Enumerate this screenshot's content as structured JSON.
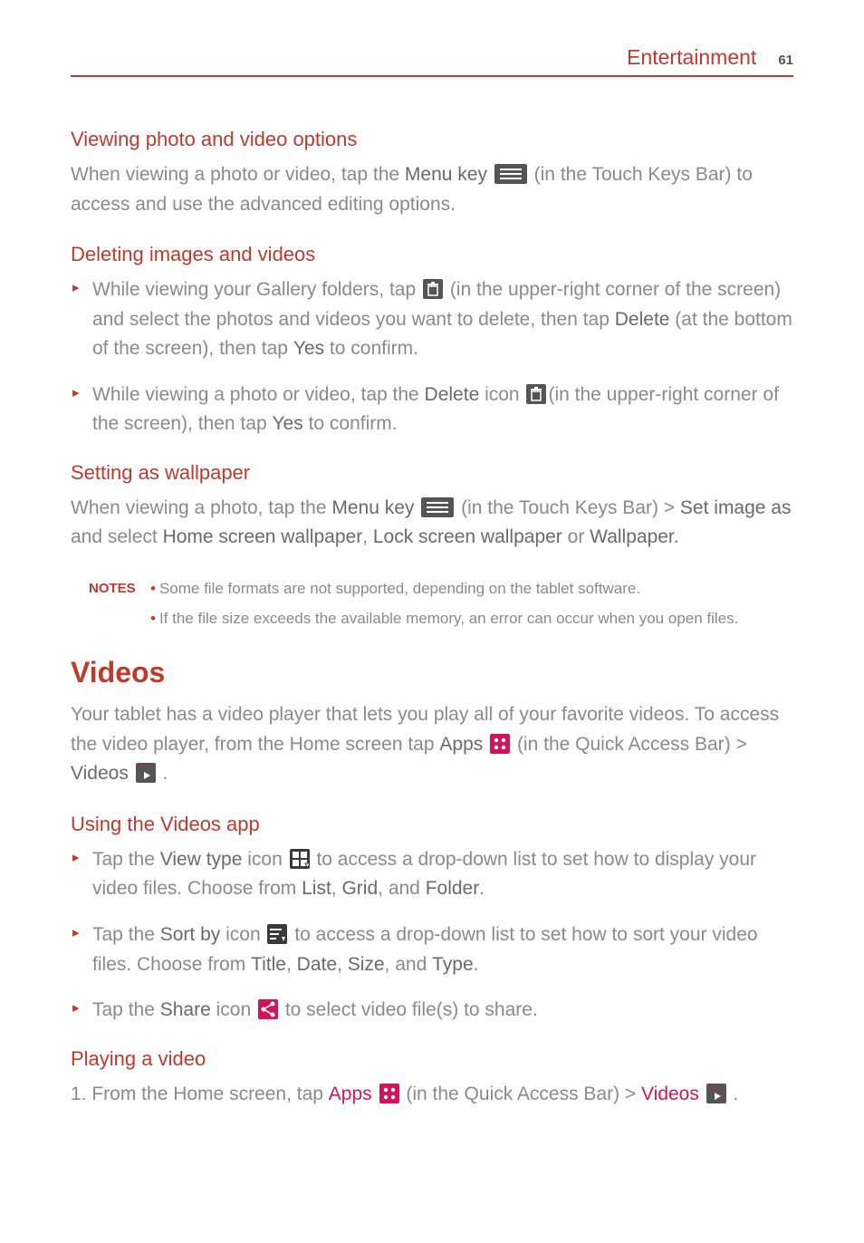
{
  "header": {
    "title": "Entertainment",
    "page": "61"
  },
  "s1": {
    "heading": "Viewing photo and video options",
    "p_a": "When viewing a photo or video, tap the ",
    "p_b": "Menu key",
    "p_c": " (in the Touch Keys Bar) to access and use the advanced editing options."
  },
  "s2": {
    "heading": "Deleting images and videos",
    "b1_a": "While viewing your Gallery folders, tap ",
    "b1_b": " (in the upper-right corner of the screen) and select the photos and videos you want to delete, then tap ",
    "b1_c": "Delete",
    "b1_d": " (at the bottom of the screen), then tap ",
    "b1_e": "Yes",
    "b1_f": " to confirm.",
    "b2_a": "While viewing a photo or video, tap the ",
    "b2_b": "Delete",
    "b2_c": " icon ",
    "b2_d": "(in the upper-right corner of the screen), then tap ",
    "b2_e": "Yes",
    "b2_f": " to confirm."
  },
  "s3": {
    "heading": "Setting as wallpaper",
    "p_a": "When viewing a photo, tap the ",
    "p_b": "Menu key",
    "p_c": " (in the Touch Keys Bar) > ",
    "p_d": "Set image as",
    "p_e": " and select ",
    "p_f": "Home screen wallpaper",
    "p_g": ", ",
    "p_h": "Lock screen wallpaper",
    "p_i": " or ",
    "p_j": "Wallpaper."
  },
  "notes": {
    "label": "NOTES",
    "n1": "Some file formats are not supported, depending on the tablet software.",
    "n2": "If the file size exceeds the available memory, an error can occur when you open files."
  },
  "s4": {
    "heading": "Videos",
    "p_a": "Your tablet has a video player that lets you play all of your favorite videos. To access the video player, from the Home screen tap ",
    "p_b": "Apps",
    "p_c": " (in the Quick Access Bar) > ",
    "p_d": "Videos",
    "p_e": " ."
  },
  "s5": {
    "heading": "Using the Videos app",
    "b1_a": "Tap the ",
    "b1_b": "View type",
    "b1_c": " icon ",
    "b1_d": " to access a drop-down list to set how to display your video files. Choose from ",
    "b1_e": "List",
    "b1_f": ", ",
    "b1_g": "Grid",
    "b1_h": ", and ",
    "b1_i": "Folder",
    "b1_j": ".",
    "b2_a": "Tap the ",
    "b2_b": "Sort by",
    "b2_c": " icon ",
    "b2_d": " to access a drop-down list to set how to sort your video files. Choose from ",
    "b2_e": "Title",
    "b2_f": ", ",
    "b2_g": "Date",
    "b2_h": ", ",
    "b2_i": "Size",
    "b2_j": ", and ",
    "b2_k": "Type",
    "b2_l": ".",
    "b3_a": "Tap the ",
    "b3_b": "Share",
    "b3_c": " icon ",
    "b3_d": " to select video file(s) to share."
  },
  "s6": {
    "heading": "Playing a video",
    "step_num": "1.  ",
    "step_a": "From the Home screen, tap ",
    "step_b": "Apps",
    "step_c": "  (in the Quick Access Bar) > ",
    "step_d": "Videos",
    "step_e": " ."
  }
}
